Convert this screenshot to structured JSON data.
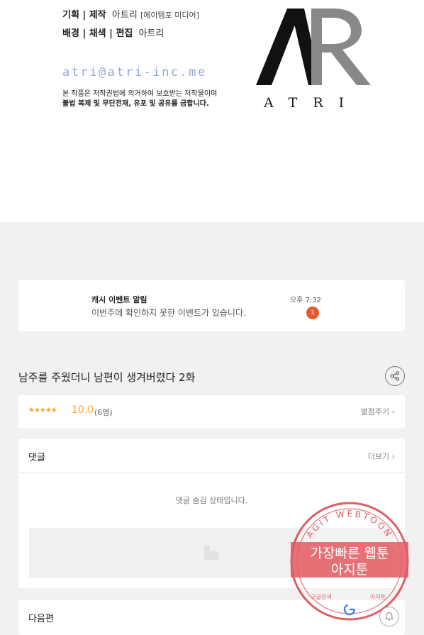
{
  "credits": {
    "line1_label": "기획 | 제작",
    "line1_value": "아트리",
    "line1_extra": "[에이템포 미디어]",
    "line2_label": "배경 | 채색 | 편집",
    "line2_value": "아트리",
    "email": "atri@atri-inc.me",
    "notice_line1": "본 작품은 저작권법에 의거하여 보호받는 저작물이며",
    "notice_line2": "불법 복제 및 무단전재, 유포 및 공유를 금합니다.",
    "logo_text": "ATRI"
  },
  "event": {
    "title": "캐시 이벤트 알림",
    "message": "이번주에 확인하지 못한 이벤트가 있습니다.",
    "time": "오후 7:32",
    "badge": "1"
  },
  "episode": {
    "title": "남주를 주웠더니 남편이 생겨버렸다 2화"
  },
  "rating": {
    "stars": "★★★★★",
    "score": "10.0",
    "count": "(6명)",
    "rate_link": "별점주기 ›"
  },
  "comments": {
    "label": "댓글",
    "more": "더보기 ›",
    "hidden_message": "댓글 숨김 상태입니다."
  },
  "next": {
    "label": "다음편"
  },
  "watermark": {
    "ring_text": "AGIT WEBTOON",
    "line1": "가장빠른 웹툰",
    "line2": "아지툰",
    "bottom_left": "구글검색",
    "bottom_right": "아지툰"
  },
  "colors": {
    "accent_star": "#f5a623",
    "badge": "#e8592d",
    "email": "#8fa6dc",
    "watermark": "#d9434b"
  }
}
